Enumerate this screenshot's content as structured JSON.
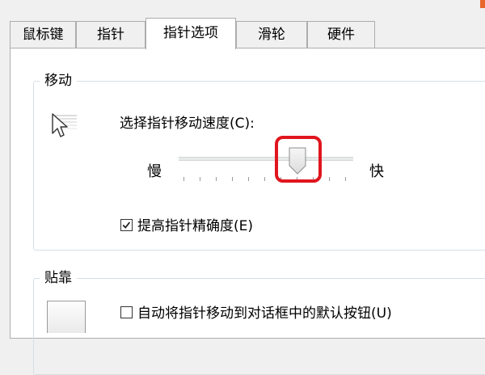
{
  "tabs": [
    {
      "label": "鼠标键",
      "active": false
    },
    {
      "label": "指针",
      "active": false
    },
    {
      "label": "指针选项",
      "active": true
    },
    {
      "label": "滑轮",
      "active": false
    },
    {
      "label": "硬件",
      "active": false
    }
  ],
  "motion": {
    "title": "移动",
    "prompt": "选择指针移动速度(C):",
    "slow_label": "慢",
    "fast_label": "快",
    "speed_fraction": 0.7,
    "enhance_precision": {
      "label": "提高指针精确度(E)",
      "checked": true
    }
  },
  "snap_to": {
    "title": "贴靠",
    "auto_move": {
      "label": "自动将指针移动到对话框中的默认按钮(U)",
      "checked": false
    }
  },
  "colors": {
    "highlight": "#e0151e",
    "accent": "#e8662b"
  },
  "icons": [
    "pointer-trails-icon",
    "slider-thumb-icon",
    "checkmark-icon",
    "snap-to-icon"
  ]
}
